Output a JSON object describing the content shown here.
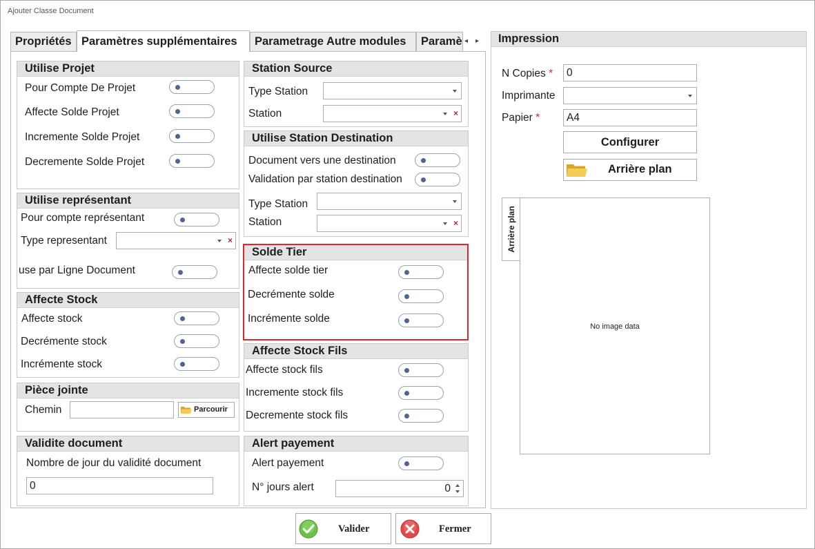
{
  "window": {
    "title": "Ajouter Classe Document"
  },
  "tabs": [
    "Propriétés",
    "Paramètres supplémentaires",
    "Parametrage Autre modules",
    "Paramè"
  ],
  "utilise_projet": {
    "title": "Utilise Projet",
    "items": [
      "Pour Compte De Projet",
      "Affecte Solde Projet",
      "Incremente Solde Projet",
      "Decremente Solde Projet"
    ]
  },
  "utilise_representant": {
    "title": "Utilise représentant",
    "pour_compte": "Pour compte représentant",
    "type_label": "Type representant",
    "use_ligne": "use par Ligne Document"
  },
  "affecte_stock": {
    "title": "Affecte Stock",
    "items": [
      "Affecte stock",
      "Decrémente stock",
      "Incrémente stock"
    ]
  },
  "piece_jointe": {
    "title": "Pièce jointe",
    "chemin_label": "Chemin",
    "chemin_value": "",
    "parcourir": "Parcourir"
  },
  "validite": {
    "title": "Validite document",
    "label": "Nombre de jour du validité document",
    "value": "0"
  },
  "station_source": {
    "title": "Station Source",
    "type_label": "Type Station",
    "station_label": "Station"
  },
  "station_dest": {
    "title": "Utilise Station Destination",
    "doc_vers": "Document vers une destination",
    "validation": "Validation par station destination",
    "type_label": "Type Station",
    "station_label": "Station"
  },
  "solde_tier": {
    "title": "Solde Tier",
    "items": [
      "Affecte solde tier",
      "Decrémente solde",
      "Incrémente solde"
    ]
  },
  "affecte_stock_fils": {
    "title": "Affecte Stock Fils",
    "items": [
      "Affecte stock fils",
      "Incremente stock fils",
      "Decremente stock fils"
    ]
  },
  "alert_payement": {
    "title": "Alert payement",
    "label": "Alert payement",
    "jours_label": "N° jours alert",
    "jours_value": "0"
  },
  "impression": {
    "title": "Impression",
    "n_copies_label": "N Copies",
    "n_copies_value": "0",
    "imprimante_label": "Imprimante",
    "papier_label": "Papier",
    "papier_value": "A4",
    "required_mark": "*",
    "configurer": "Configurer",
    "arriere_plan_btn": "Arrière plan",
    "arriere_plan_tab": "Arrière plan",
    "no_image": "No image data"
  },
  "footer": {
    "valider": "Valider",
    "fermer": "Fermer"
  },
  "colors": {
    "highlight": "#e0262e",
    "toggle_dot": "#4e6492",
    "group_header": "#e4e4e4"
  }
}
